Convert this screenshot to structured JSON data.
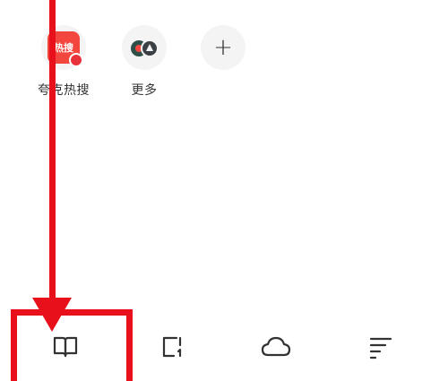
{
  "shortcuts": {
    "hotsearch": {
      "label": "夸克热搜",
      "badge_text": "热搜",
      "icon": "hot-search-icon"
    },
    "more": {
      "label": "更多",
      "icon": "more-apps-icon"
    },
    "add": {
      "symbol": "+",
      "icon": "plus-icon"
    }
  },
  "tabbar": {
    "items": [
      {
        "icon": "book-icon"
      },
      {
        "icon": "pages-icon"
      },
      {
        "icon": "cloud-icon"
      },
      {
        "icon": "menu-icon"
      }
    ]
  },
  "colors": {
    "annotation": "#e8101a",
    "hot_badge": "#f3463f",
    "icon_stroke": "#333333"
  }
}
